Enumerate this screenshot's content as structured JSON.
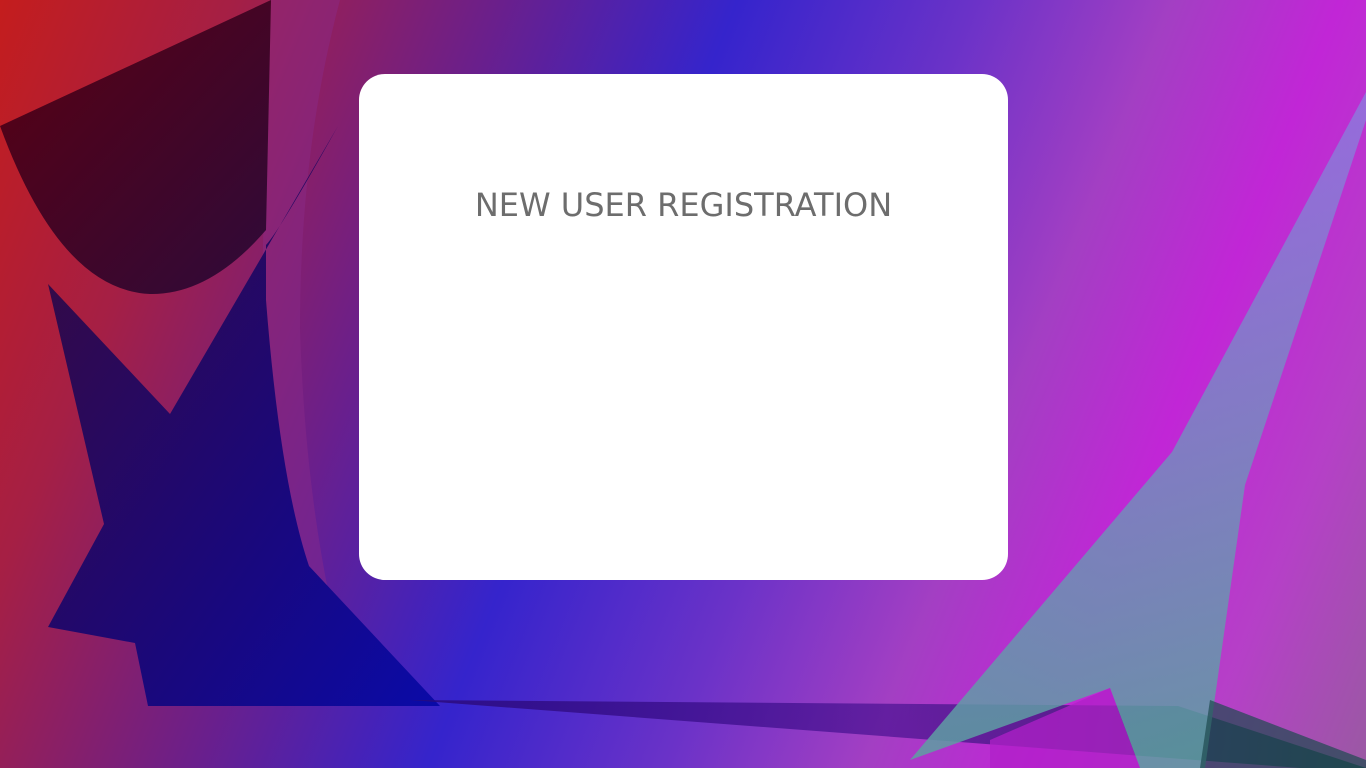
{
  "page": {
    "title": "NEW USER REGISTRATION"
  },
  "colors": {
    "card_background": "#ffffff",
    "title_text": "#6d6d6d",
    "background_red": "#c41d1d",
    "background_blue": "#3524cc",
    "background_magenta": "#c126d6"
  }
}
